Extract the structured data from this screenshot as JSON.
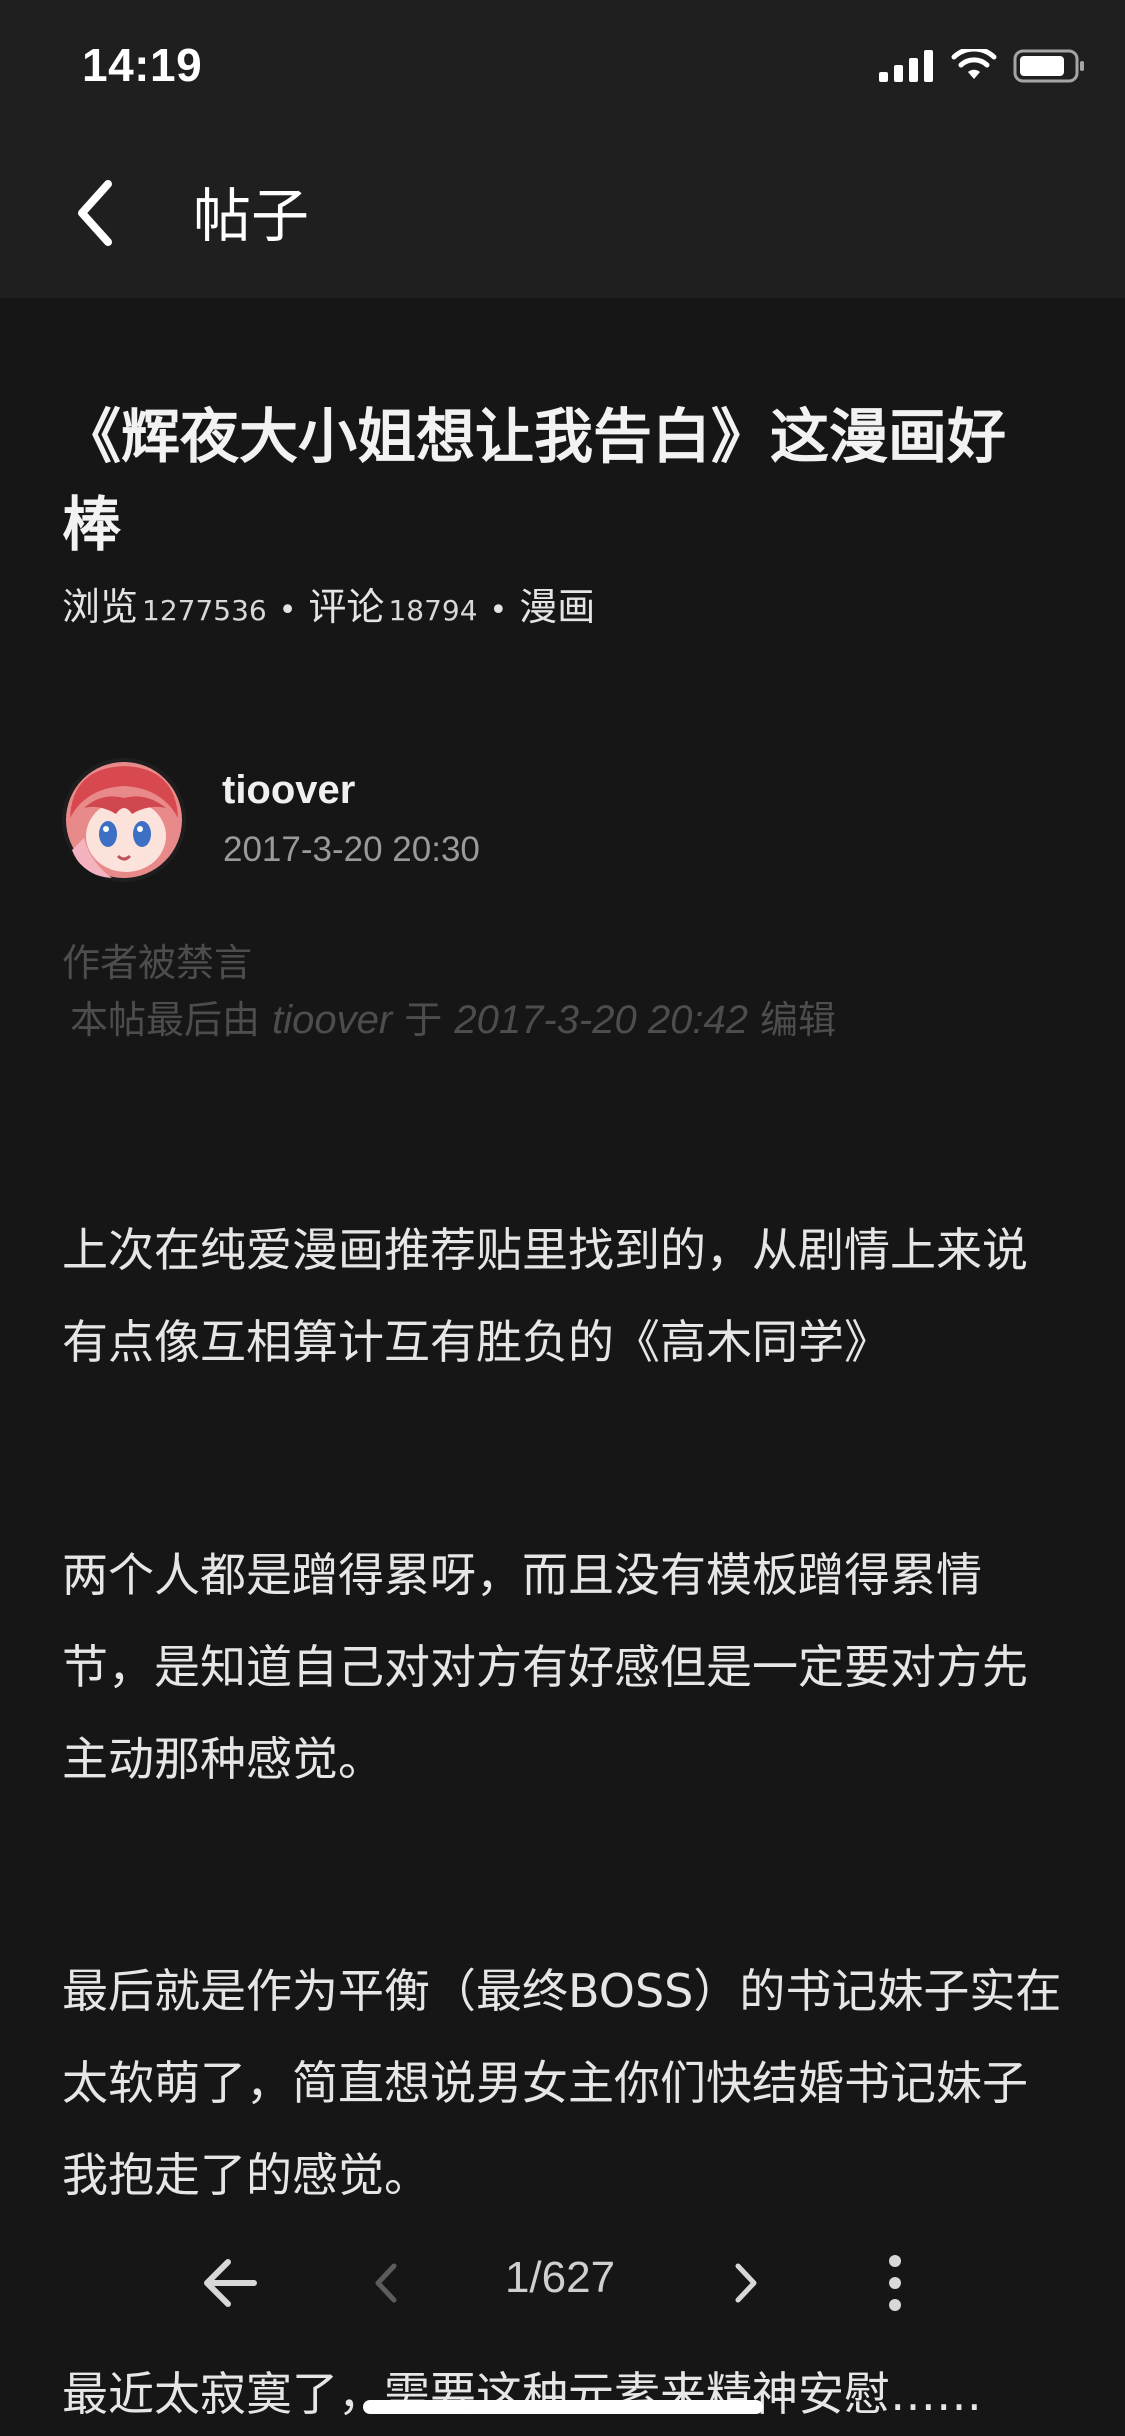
{
  "status_bar": {
    "time": "14:19",
    "icons": [
      "signal-icon",
      "wifi-icon",
      "battery-icon"
    ]
  },
  "nav": {
    "back_icon": "chevron-left-icon",
    "title": "帖子"
  },
  "post": {
    "title": "《辉夜大小姐想让我告白》这漫画好棒",
    "meta": {
      "views_label": "浏览",
      "views": "1277536",
      "comments_label": "评论",
      "comments": "18794",
      "category": "漫画"
    },
    "author": {
      "name": "tioover",
      "date": "2017-3-20 20:30"
    },
    "banned_notice": "作者被禁言",
    "edit_note": {
      "prefix": "本帖最后由",
      "user": "tioover",
      "middle": "于",
      "time": "2017-3-20 20:42",
      "suffix": "编辑"
    },
    "paragraphs": [
      "上次在纯爱漫画推荐贴里找到的，从剧情上来说有点像互相算计互有胜负的《高木同学》",
      "两个人都是蹭得累呀，而且没有模板蹭得累情节，是知道自己对对方有好感但是一定要对方先主动那种感觉。",
      "最后就是作为平衡（最终BOSS）的书记妹子实在太软萌了，简直想说男女主你们快结婚书记妹子我抱走了的感觉。",
      "最近太寂寞了，需要这种元素来精神安慰……"
    ]
  },
  "bottom_bar": {
    "page_indicator": "1/627",
    "icons": [
      "arrow-left-icon",
      "chevron-left-icon",
      "chevron-right-icon",
      "more-vertical-icon"
    ]
  },
  "colors": {
    "background": "#161616",
    "header": "#1f1f1f",
    "text": "#e9e9e9",
    "muted": "#4d4d4d"
  }
}
